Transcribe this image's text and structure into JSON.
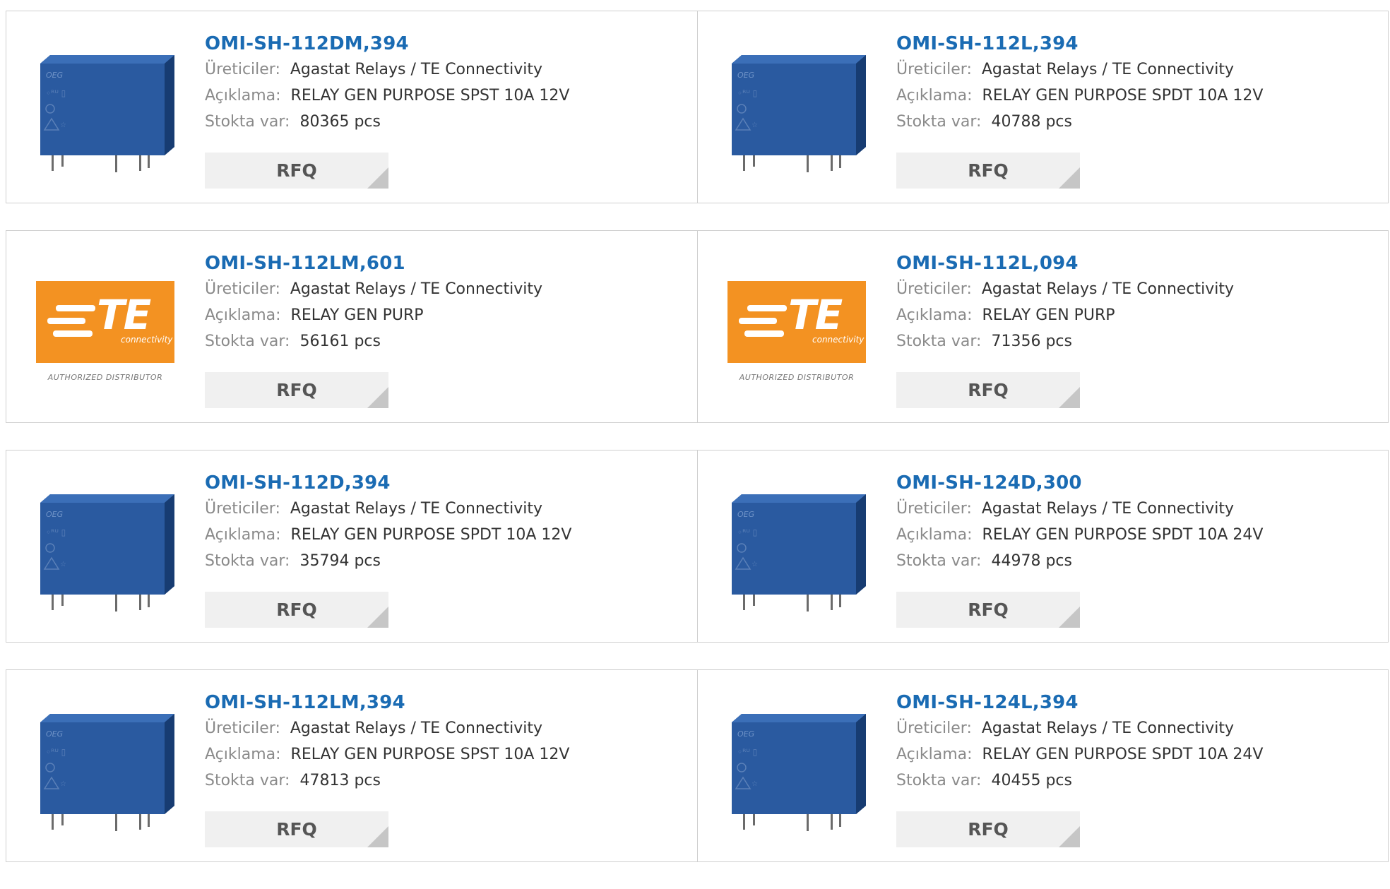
{
  "labels": {
    "manufacturer": "Üreticiler:",
    "description": "Açıklama:",
    "stock": "Stokta var:",
    "rfq": "RFQ",
    "te_brand": "TE",
    "te_sub": "connectivity",
    "te_authorized": "AUTHORIZED DISTRIBUTOR"
  },
  "colors": {
    "part_link": "#1a6bb3",
    "te_orange": "#f39222",
    "relay_blue": "#2a5aa0"
  },
  "products": [
    {
      "part": "OMI-SH-112DM,394",
      "manufacturer": "Agastat Relays / TE Connectivity",
      "description": "RELAY GEN PURPOSE SPST 10A 12V",
      "stock": "80365 pcs",
      "image": "relay-image"
    },
    {
      "part": "OMI-SH-112L,394",
      "manufacturer": "Agastat Relays / TE Connectivity",
      "description": "RELAY GEN PURPOSE SPDT 10A 12V",
      "stock": "40788 pcs",
      "image": "relay-image"
    },
    {
      "part": "OMI-SH-112LM,601",
      "manufacturer": "Agastat Relays / TE Connectivity",
      "description": "RELAY GEN PURP",
      "stock": "56161 pcs",
      "image": "te-logo"
    },
    {
      "part": "OMI-SH-112L,094",
      "manufacturer": "Agastat Relays / TE Connectivity",
      "description": "RELAY GEN PURP",
      "stock": "71356 pcs",
      "image": "te-logo"
    },
    {
      "part": "OMI-SH-112D,394",
      "manufacturer": "Agastat Relays / TE Connectivity",
      "description": "RELAY GEN PURPOSE SPDT 10A 12V",
      "stock": "35794 pcs",
      "image": "relay-image"
    },
    {
      "part": "OMI-SH-124D,300",
      "manufacturer": "Agastat Relays / TE Connectivity",
      "description": "RELAY GEN PURPOSE SPDT 10A 24V",
      "stock": "44978 pcs",
      "image": "relay-image"
    },
    {
      "part": "OMI-SH-112LM,394",
      "manufacturer": "Agastat Relays / TE Connectivity",
      "description": "RELAY GEN PURPOSE SPST 10A 12V",
      "stock": "47813 pcs",
      "image": "relay-image"
    },
    {
      "part": "OMI-SH-124L,394",
      "manufacturer": "Agastat Relays / TE Connectivity",
      "description": "RELAY GEN PURPOSE SPDT 10A 24V",
      "stock": "40455 pcs",
      "image": "relay-image"
    }
  ]
}
